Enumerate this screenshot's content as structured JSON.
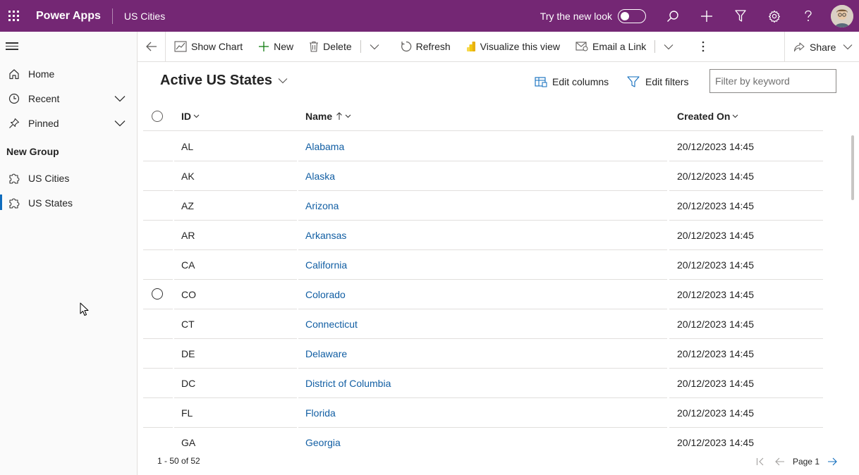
{
  "header": {
    "app_name": "Power Apps",
    "app_title": "US Cities",
    "try_new_look_label": "Try the new look",
    "icons": [
      "app-launcher-icon",
      "search-icon",
      "add-icon",
      "filter-icon",
      "settings-icon",
      "help-icon"
    ],
    "colors": {
      "header_bg": "#742774"
    }
  },
  "nav": {
    "items": [
      {
        "label": "Home",
        "icon": "home-icon"
      },
      {
        "label": "Recent",
        "icon": "clock-icon",
        "expandable": true
      },
      {
        "label": "Pinned",
        "icon": "pin-icon",
        "expandable": true
      }
    ],
    "group_label": "New Group",
    "group_items": [
      {
        "label": "US Cities",
        "icon": "puzzle-icon",
        "active": false
      },
      {
        "label": "US States",
        "icon": "puzzle-icon",
        "active": true
      }
    ]
  },
  "commandbar": {
    "show_chart": "Show Chart",
    "new": "New",
    "delete": "Delete",
    "refresh": "Refresh",
    "visualize": "Visualize this view",
    "email_link": "Email a Link",
    "share": "Share"
  },
  "view": {
    "title": "Active US States",
    "edit_columns": "Edit columns",
    "edit_filters": "Edit filters",
    "filter_placeholder": "Filter by keyword"
  },
  "grid": {
    "columns": {
      "id": "ID",
      "name": "Name",
      "created_on": "Created On"
    },
    "sort": {
      "column": "Name",
      "direction": "ascending"
    },
    "rows": [
      {
        "id": "AL",
        "name": "Alabama",
        "created_on": "20/12/2023 14:45"
      },
      {
        "id": "AK",
        "name": "Alaska",
        "created_on": "20/12/2023 14:45"
      },
      {
        "id": "AZ",
        "name": "Arizona",
        "created_on": "20/12/2023 14:45"
      },
      {
        "id": "AR",
        "name": "Arkansas",
        "created_on": "20/12/2023 14:45"
      },
      {
        "id": "CA",
        "name": "California",
        "created_on": "20/12/2023 14:45"
      },
      {
        "id": "CO",
        "name": "Colorado",
        "created_on": "20/12/2023 14:45"
      },
      {
        "id": "CT",
        "name": "Connecticut",
        "created_on": "20/12/2023 14:45"
      },
      {
        "id": "DE",
        "name": "Delaware",
        "created_on": "20/12/2023 14:45"
      },
      {
        "id": "DC",
        "name": "District of Columbia",
        "created_on": "20/12/2023 14:45"
      },
      {
        "id": "FL",
        "name": "Florida",
        "created_on": "20/12/2023 14:45"
      },
      {
        "id": "GA",
        "name": "Georgia",
        "created_on": "20/12/2023 14:45"
      }
    ]
  },
  "footer": {
    "record_count": "1 - 50 of 52",
    "page_label": "Page 1"
  }
}
